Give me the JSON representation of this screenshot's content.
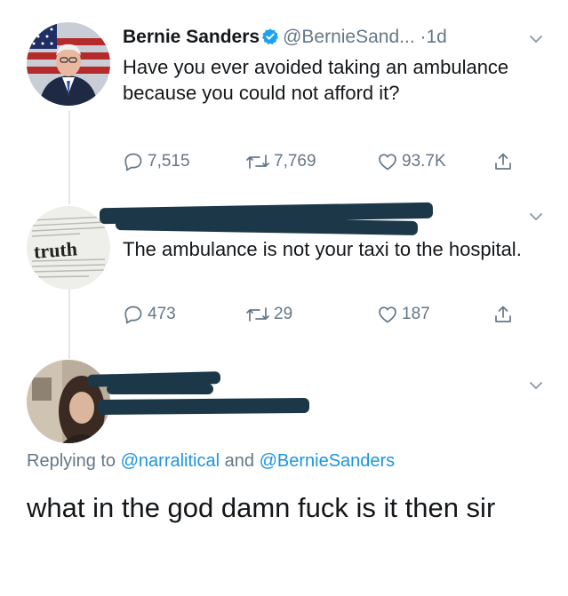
{
  "tweets": [
    {
      "display_name": "Bernie Sanders",
      "handle": "@BernieSand...",
      "dot": "·",
      "time": "1d",
      "text": "Have you ever avoided taking an ambulance because you could not afford it?",
      "replies": "7,515",
      "retweets": "7,769",
      "likes": "93.7K"
    },
    {
      "avatar_text": "truth",
      "text": "The ambulance is not your taxi to the hospital.",
      "replies": "473",
      "retweets": "29",
      "likes": "187"
    }
  ],
  "reply": {
    "replying_prefix": "Replying to",
    "mention_1": "@narralitical",
    "conjunction": "and",
    "mention_2": "@BernieSanders",
    "text": "what in the god damn fuck is it then sir"
  },
  "colors": {
    "text": "#14171a",
    "secondary": "#657786",
    "link": "#1b95e0",
    "verified": "#1da1f2",
    "redaction": "#1c3848"
  },
  "icons": [
    "verified-badge-icon",
    "chevron-down-icon",
    "reply-icon",
    "retweet-icon",
    "like-icon",
    "share-icon"
  ]
}
